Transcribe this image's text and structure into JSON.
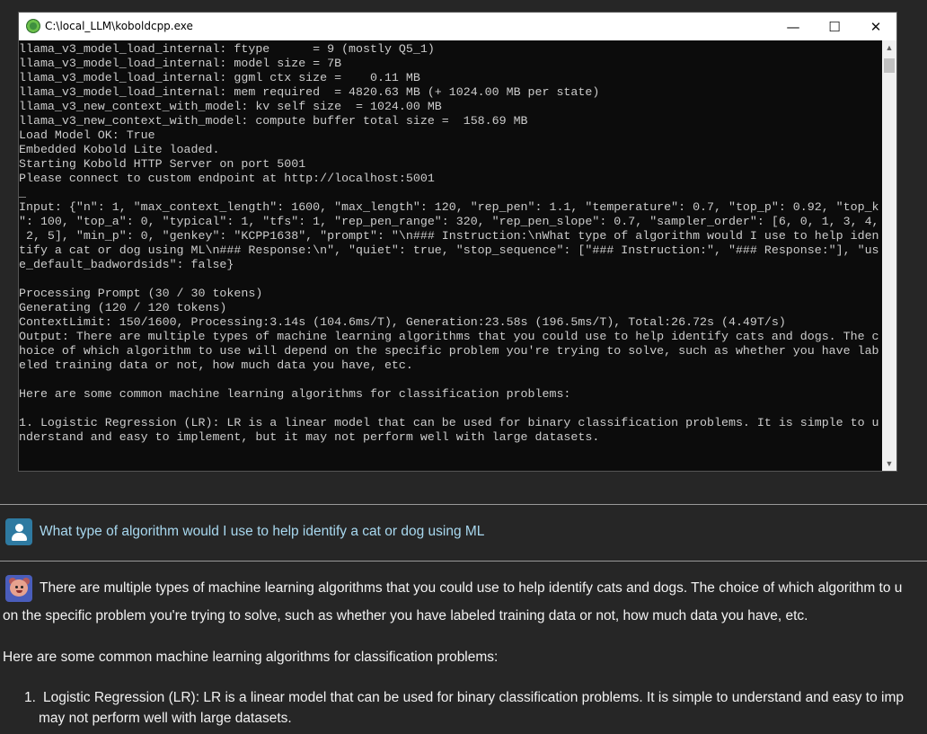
{
  "window": {
    "title": "C:\\local_LLM\\koboldcpp.exe",
    "minimize_glyph": "—",
    "maximize_glyph": "☐",
    "close_glyph": "✕",
    "app_icon": "koboldcpp-icon",
    "scroll_up_glyph": "▲",
    "scroll_down_glyph": "▼"
  },
  "console": {
    "lines": [
      "llama_v3_model_load_internal: ftype      = 9 (mostly Q5_1)",
      "llama_v3_model_load_internal: model size = 7B",
      "llama_v3_model_load_internal: ggml ctx size =    0.11 MB",
      "llama_v3_model_load_internal: mem required  = 4820.63 MB (+ 1024.00 MB per state)",
      "llama_v3_new_context_with_model: kv self size  = 1024.00 MB",
      "llama_v3_new_context_with_model: compute buffer total size =  158.69 MB",
      "Load Model OK: True",
      "Embedded Kobold Lite loaded.",
      "Starting Kobold HTTP Server on port 5001",
      "Please connect to custom endpoint at http://localhost:5001",
      "_",
      "Input: {\"n\": 1, \"max_context_length\": 1600, \"max_length\": 120, \"rep_pen\": 1.1, \"temperature\": 0.7, \"top_p\": 0.92, \"top_k",
      "\": 100, \"top_a\": 0, \"typical\": 1, \"tfs\": 1, \"rep_pen_range\": 320, \"rep_pen_slope\": 0.7, \"sampler_order\": [6, 0, 1, 3, 4,",
      " 2, 5], \"min_p\": 0, \"genkey\": \"KCPP1638\", \"prompt\": \"\\n### Instruction:\\nWhat type of algorithm would I use to help iden",
      "tify a cat or dog using ML\\n### Response:\\n\", \"quiet\": true, \"stop_sequence\": [\"### Instruction:\", \"### Response:\"], \"us",
      "e_default_badwordsids\": false}",
      "",
      "Processing Prompt (30 / 30 tokens)",
      "Generating (120 / 120 tokens)",
      "ContextLimit: 150/1600, Processing:3.14s (104.6ms/T), Generation:23.58s (196.5ms/T), Total:26.72s (4.49T/s)",
      "Output: There are multiple types of machine learning algorithms that you could use to help identify cats and dogs. The c",
      "hoice of which algorithm to use will depend on the specific problem you're trying to solve, such as whether you have lab",
      "eled training data or not, how much data you have, etc.",
      "",
      "Here are some common machine learning algorithms for classification problems:",
      "",
      "1. Logistic Regression (LR): LR is a linear model that can be used for binary classification problems. It is simple to u",
      "nderstand and easy to implement, but it may not perform well with large datasets."
    ]
  },
  "chat": {
    "user_avatar_icon": "user-avatar-icon",
    "bot_avatar_icon": "kobold-avatar-icon",
    "user_message": "What type of algorithm would I use to help identify a cat or dog using ML",
    "bot_line_1": "There are multiple types of machine learning algorithms that you could use to help identify cats and dogs. The choice of which algorithm to u",
    "bot_line_2": "on the specific problem you're trying to solve, such as whether you have labeled training data or not, how much data you have, etc.",
    "bot_line_3": "Here are some common machine learning algorithms for classification problems:",
    "bot_list_number": "1.",
    "bot_line_4": "Logistic Regression (LR): LR is a linear model that can be used for binary classification problems. It is simple to understand and easy to imp",
    "bot_line_5": "may not perform well with large datasets."
  }
}
